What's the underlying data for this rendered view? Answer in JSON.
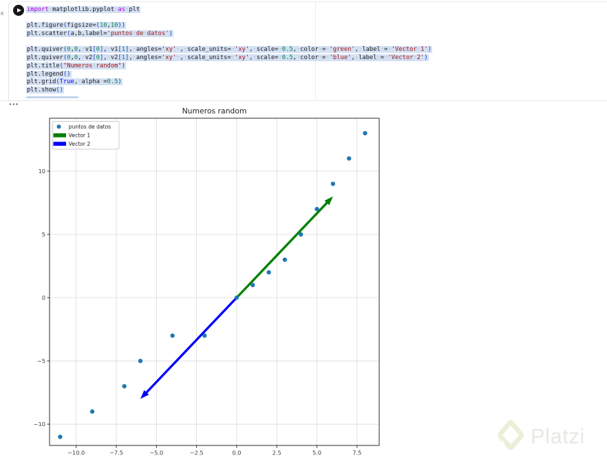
{
  "editor": {
    "run_button_label": "run-cell",
    "code_lines": [
      [
        [
          "import",
          "kw"
        ],
        [
          " "
        ],
        [
          "matplotlib.pyplot"
        ],
        [
          " "
        ],
        [
          "as",
          "kw"
        ],
        [
          " "
        ],
        [
          "plt"
        ]
      ],
      [],
      [
        [
          "plt.figure"
        ],
        [
          "(",
          "br"
        ],
        [
          "figsize="
        ],
        [
          "(",
          "br"
        ],
        [
          "10",
          "num"
        ],
        [
          ","
        ],
        [
          "10",
          "num"
        ],
        [
          ")",
          "br"
        ],
        [
          ")",
          "br"
        ]
      ],
      [
        [
          "plt.scatter"
        ],
        [
          "(",
          "br"
        ],
        [
          "a,b,label="
        ],
        [
          "'puntos de datos'",
          "str"
        ],
        [
          ")",
          "br"
        ]
      ],
      [],
      [
        [
          "plt.quiver"
        ],
        [
          "(",
          "br"
        ],
        [
          "0",
          "num"
        ],
        [
          ","
        ],
        [
          "0",
          "num"
        ],
        [
          ", v1"
        ],
        [
          "[",
          "br"
        ],
        [
          "0",
          "num"
        ],
        [
          "]",
          "br"
        ],
        [
          ", v1"
        ],
        [
          "[",
          "br"
        ],
        [
          "1",
          "num"
        ],
        [
          "]",
          "br"
        ],
        [
          ", angles="
        ],
        [
          "'xy'",
          "str"
        ],
        [
          " , scale_units= "
        ],
        [
          "'xy'",
          "str"
        ],
        [
          ", scale= "
        ],
        [
          "0.5",
          "num"
        ],
        [
          ", color = "
        ],
        [
          "'green'",
          "str"
        ],
        [
          ", label = "
        ],
        [
          "'Vector 1'",
          "str"
        ],
        [
          ")",
          "br"
        ]
      ],
      [
        [
          "plt.quiver"
        ],
        [
          "(",
          "br"
        ],
        [
          "0",
          "num"
        ],
        [
          ","
        ],
        [
          "0",
          "num"
        ],
        [
          ", v2"
        ],
        [
          "[",
          "br"
        ],
        [
          "0",
          "num"
        ],
        [
          "]",
          "br"
        ],
        [
          ", v2"
        ],
        [
          "[",
          "br"
        ],
        [
          "1",
          "num"
        ],
        [
          "]",
          "br"
        ],
        [
          ", angles="
        ],
        [
          "'xy'",
          "str"
        ],
        [
          " , scale_units= "
        ],
        [
          "'xy'",
          "str"
        ],
        [
          ", scale= "
        ],
        [
          "0.5",
          "num"
        ],
        [
          ", color = "
        ],
        [
          "'blue'",
          "str"
        ],
        [
          ", label = "
        ],
        [
          "'Vector 2'",
          "str"
        ],
        [
          ")",
          "br"
        ]
      ],
      [
        [
          "plt.title"
        ],
        [
          "(",
          "br"
        ],
        [
          "\"Numeros random\"",
          "str"
        ],
        [
          ")",
          "br"
        ]
      ],
      [
        [
          "plt.legend"
        ],
        [
          "(",
          "br"
        ],
        [
          ")",
          "br"
        ]
      ],
      [
        [
          "plt.grid"
        ],
        [
          "(",
          "br"
        ],
        [
          "True",
          "bool"
        ],
        [
          ", alpha ="
        ],
        [
          "0.5",
          "num"
        ],
        [
          ")",
          "br"
        ]
      ],
      [
        [
          "plt.show"
        ],
        [
          "(",
          "br"
        ],
        [
          ")",
          "br"
        ]
      ]
    ]
  },
  "output": {
    "more_actions": "···"
  },
  "chart_data": {
    "type": "scatter",
    "title": "Numeros random",
    "xlabel": "",
    "ylabel": "",
    "points": [
      [
        -11,
        -11
      ],
      [
        -9,
        -9
      ],
      [
        -7,
        -7
      ],
      [
        -6,
        -5
      ],
      [
        -4,
        -3
      ],
      [
        -2,
        -3
      ],
      [
        0,
        0
      ],
      [
        1,
        1
      ],
      [
        2,
        2
      ],
      [
        3,
        3
      ],
      [
        4,
        5
      ],
      [
        5,
        7
      ],
      [
        6,
        9
      ],
      [
        7,
        11
      ],
      [
        8,
        13
      ]
    ],
    "point_color": "#1f77b4",
    "vectors": [
      {
        "name": "Vector 1",
        "from": [
          0,
          0
        ],
        "to": [
          6,
          8
        ],
        "color": "#008000"
      },
      {
        "name": "Vector 2",
        "from": [
          0,
          0
        ],
        "to": [
          -6,
          -8
        ],
        "color": "#0000ff"
      }
    ],
    "xlim": [
      -11.66,
      8.88
    ],
    "ylim": [
      -11.68,
      14.18
    ],
    "xticks": [
      -10,
      -7.5,
      -5,
      -2.5,
      0,
      2.5,
      5,
      7.5
    ],
    "xtick_labels": [
      "−10.0",
      "−7.5",
      "−5.0",
      "−2.5",
      "0.0",
      "2.5",
      "5.0",
      "7.5"
    ],
    "yticks": [
      10,
      5,
      0,
      -5,
      -10
    ],
    "ytick_labels": [
      "10",
      "5",
      "0",
      "−5",
      "−10"
    ],
    "grid": true,
    "grid_alpha": 0.5,
    "legend": {
      "position": "upper left",
      "entries": [
        {
          "label": "puntos de datos",
          "marker": "dot",
          "color": "#1f77b4"
        },
        {
          "label": "Vector 1",
          "marker": "bar",
          "color": "#008000"
        },
        {
          "label": "Vector 2",
          "marker": "bar",
          "color": "#0000ff"
        }
      ]
    }
  },
  "watermark": {
    "text": "Platzi",
    "logo_color": "#eaf0d8",
    "text_color": "#e8e8e3"
  }
}
